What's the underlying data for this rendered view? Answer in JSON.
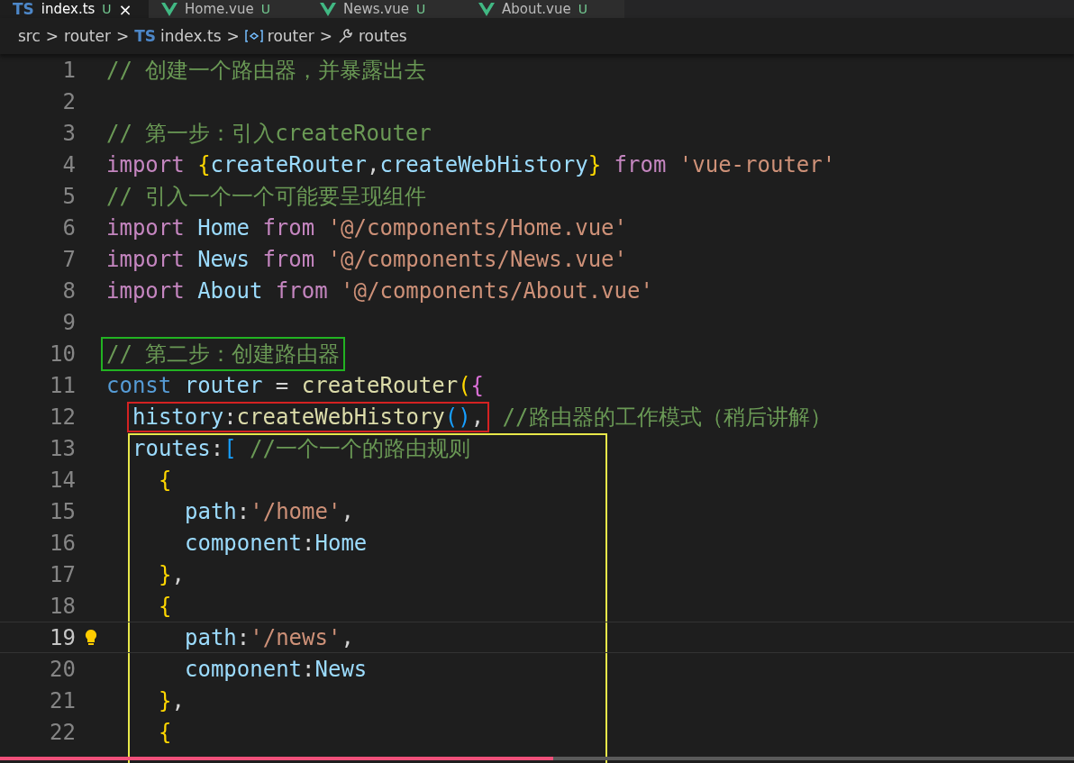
{
  "tabs": [
    {
      "label": "index.ts",
      "kind": "typescript",
      "badge": "TS",
      "status": "U",
      "selected": true,
      "close": "×"
    },
    {
      "label": "Home.vue",
      "kind": "vue",
      "status": "U",
      "selected": false
    },
    {
      "label": "News.vue",
      "kind": "vue",
      "status": "U",
      "selected": false
    },
    {
      "label": "About.vue",
      "kind": "vue",
      "status": "U",
      "selected": false
    }
  ],
  "breadcrumbs": [
    {
      "label": "src",
      "kind": "folder"
    },
    {
      "label": "router",
      "kind": "folder"
    },
    {
      "label": "index.ts",
      "kind": "typescript",
      "badge": "TS"
    },
    {
      "label": "router",
      "kind": "variable"
    },
    {
      "label": "routes",
      "kind": "property"
    }
  ],
  "separator": ">",
  "lines": [
    {
      "number": "1",
      "tokens": [
        {
          "text": "// 创建一个路由器，并暴露出去",
          "kind": "comment"
        }
      ]
    },
    {
      "number": "2"
    },
    {
      "number": "3",
      "tokens": [
        {
          "text": "// 第一步：引入createRouter",
          "kind": "comment"
        }
      ]
    },
    {
      "number": "4",
      "tokens": [
        {
          "text": "import ",
          "kind": "keyword"
        },
        {
          "text": "{",
          "kind": "brace"
        },
        {
          "text": "createRouter",
          "kind": "variable"
        },
        {
          "text": ",",
          "kind": "plain"
        },
        {
          "text": "createWebHistory",
          "kind": "variable"
        },
        {
          "text": "}",
          "kind": "brace"
        },
        {
          "text": " from ",
          "kind": "keyword"
        },
        {
          "text": "'vue-router'",
          "kind": "string"
        }
      ]
    },
    {
      "number": "5",
      "tokens": [
        {
          "text": "// 引入一个一个可能要呈现组件",
          "kind": "comment"
        }
      ]
    },
    {
      "number": "6",
      "tokens": [
        {
          "text": "import ",
          "kind": "keyword"
        },
        {
          "text": "Home",
          "kind": "variable"
        },
        {
          "text": " from ",
          "kind": "keyword"
        },
        {
          "text": "'@/components/Home.vue'",
          "kind": "string"
        }
      ]
    },
    {
      "number": "7",
      "tokens": [
        {
          "text": "import ",
          "kind": "keyword"
        },
        {
          "text": "News",
          "kind": "variable"
        },
        {
          "text": " from ",
          "kind": "keyword"
        },
        {
          "text": "'@/components/News.vue'",
          "kind": "string"
        }
      ]
    },
    {
      "number": "8",
      "tokens": [
        {
          "text": "import ",
          "kind": "keyword"
        },
        {
          "text": "About",
          "kind": "variable"
        },
        {
          "text": " from ",
          "kind": "keyword"
        },
        {
          "text": "'@/components/About.vue'",
          "kind": "string"
        }
      ]
    },
    {
      "number": "9"
    },
    {
      "number": "10",
      "color": "#22b322",
      "boxed": [
        {
          "text": "// 第二步：创建路由器",
          "kind": "comment"
        }
      ]
    },
    {
      "number": "11",
      "tokens": [
        {
          "text": "const ",
          "kind": "storage"
        },
        {
          "text": "router",
          "kind": "variable"
        },
        {
          "text": " = ",
          "kind": "plain"
        },
        {
          "text": "createRouter",
          "kind": "function"
        },
        {
          "text": "(",
          "kind": "brace"
        },
        {
          "text": "{",
          "kind": "paren"
        }
      ],
      "children": [
        {
          "number": "12",
          "color": "#d42222",
          "boxed": [
            {
              "text": "history",
              "kind": "variable"
            },
            {
              "text": ":",
              "kind": "plain"
            },
            {
              "text": "createWebHistory",
              "kind": "function"
            },
            {
              "text": "()",
              "kind": "bracket"
            },
            {
              "text": ",",
              "kind": "plain"
            }
          ],
          "tokens": [
            {
              "text": " //路由器的工作模式（稍后讲解）",
              "kind": "comment"
            }
          ]
        },
        {
          "number": "13",
          "framed": true,
          "tokens": [
            {
              "text": "routes",
              "kind": "variable"
            },
            {
              "text": ":",
              "kind": "plain"
            },
            {
              "text": "[",
              "kind": "bracket"
            },
            {
              "text": " //一个一个的路由规则",
              "kind": "comment"
            }
          ],
          "children": [
            {
              "number": "14",
              "tokens": [
                {
                  "text": "{",
                  "kind": "brace"
                }
              ],
              "children": [
                {
                  "number": "15",
                  "tokens": [
                    {
                      "text": "path",
                      "kind": "variable"
                    },
                    {
                      "text": ":",
                      "kind": "plain"
                    },
                    {
                      "text": "'/home'",
                      "kind": "string"
                    },
                    {
                      "text": ",",
                      "kind": "plain"
                    }
                  ]
                },
                {
                  "number": "16",
                  "tokens": [
                    {
                      "text": "component",
                      "kind": "variable"
                    },
                    {
                      "text": ":",
                      "kind": "plain"
                    },
                    {
                      "text": "Home",
                      "kind": "variable"
                    }
                  ]
                }
              ]
            },
            {
              "number": "17",
              "tokens": [
                {
                  "text": "}",
                  "kind": "brace"
                },
                {
                  "text": ",",
                  "kind": "plain"
                }
              ]
            },
            {
              "number": "18",
              "tokens": [
                {
                  "text": "{",
                  "kind": "brace"
                }
              ],
              "children": [
                {
                  "number": "19",
                  "current": true,
                  "tokens": [
                    {
                      "text": "path",
                      "kind": "variable"
                    },
                    {
                      "text": ":",
                      "kind": "plain"
                    },
                    {
                      "text": "'/news'",
                      "kind": "string"
                    },
                    {
                      "text": ",",
                      "kind": "plain"
                    }
                  ]
                },
                {
                  "number": "20",
                  "tokens": [
                    {
                      "text": "component",
                      "kind": "variable"
                    },
                    {
                      "text": ":",
                      "kind": "plain"
                    },
                    {
                      "text": "News",
                      "kind": "variable"
                    }
                  ]
                }
              ]
            },
            {
              "number": "21",
              "tokens": [
                {
                  "text": "}",
                  "kind": "brace"
                },
                {
                  "text": ",",
                  "kind": "plain"
                }
              ]
            },
            {
              "number": "22",
              "tokens": [
                {
                  "text": "{",
                  "kind": "brace"
                }
              ]
            }
          ]
        }
      ]
    }
  ],
  "video_progress": {
    "level": 0.515
  }
}
